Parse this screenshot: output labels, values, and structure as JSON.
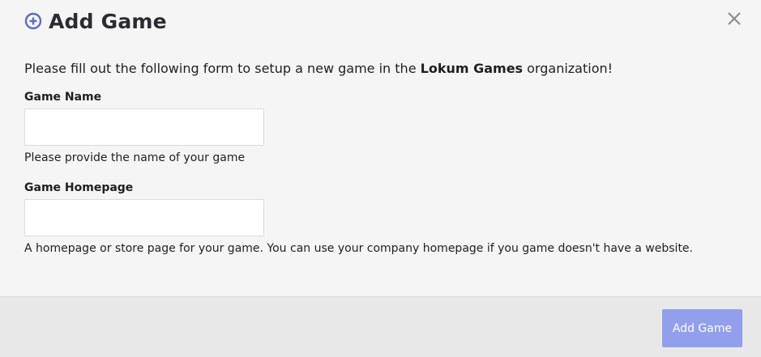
{
  "header": {
    "title": "Add Game",
    "icon": "plus-circle-icon",
    "accent": "#5c6bc0"
  },
  "close": {
    "icon": "close-icon"
  },
  "intro": {
    "prefix": "Please fill out the following form to setup a new game in the ",
    "organization": "Lokum Games",
    "suffix": " organization!"
  },
  "fields": {
    "game_name": {
      "label": "Game Name",
      "value": "",
      "placeholder": "",
      "help": "Please provide the name of your game"
    },
    "game_homepage": {
      "label": "Game Homepage",
      "value": "",
      "placeholder": "",
      "help": "A homepage or store page for your game. You can use your company homepage if you game doesn't have a website."
    }
  },
  "footer": {
    "submit_label": "Add Game",
    "submit_color": "#919fed"
  }
}
